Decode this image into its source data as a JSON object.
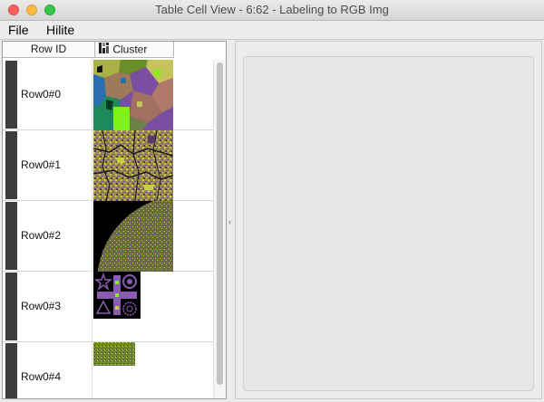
{
  "window": {
    "title": "Table Cell View - 6:62 - Labeling to RGB Img"
  },
  "menu": {
    "file": "File",
    "hilite": "Hilite"
  },
  "table": {
    "columns": {
      "row_id": "Row ID",
      "cluster": "Cluster",
      "cluster_icon": "image-type-icon"
    },
    "rows": [
      {
        "id": "Row0#0"
      },
      {
        "id": "Row0#1"
      },
      {
        "id": "Row0#2"
      },
      {
        "id": "Row0#3"
      },
      {
        "id": "Row0#4"
      }
    ]
  },
  "colors": {
    "purple": "#7b4fa0",
    "green": "#7ef21a",
    "olive": "#aab246",
    "row_marker": "#3d3d3d"
  }
}
